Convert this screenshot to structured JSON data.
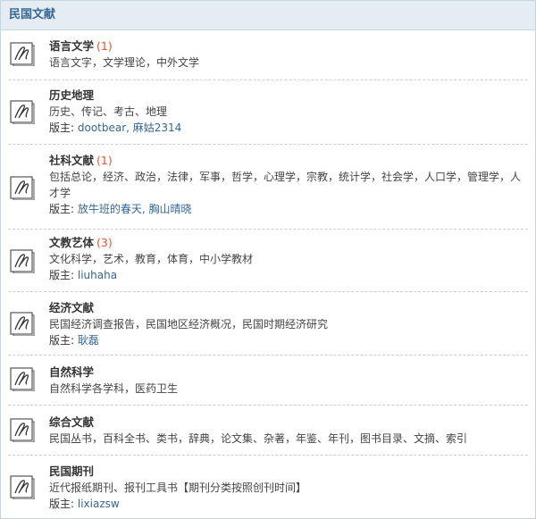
{
  "header": {
    "title": "民国文献"
  },
  "moderator_label": "版主: ",
  "forums": [
    {
      "title": "语言文学",
      "count": "(1)",
      "desc": "语言文字，文学理论，中外文学",
      "moderators": ""
    },
    {
      "title": "历史地理",
      "count": "",
      "desc": "历史、传记、考古、地理",
      "moderators": "dootbear, 麻姑2314"
    },
    {
      "title": "社科文献",
      "count": "(1)",
      "desc": "包括总论，经济、政治，法律，军事，哲学，心理学，宗教，统计学，社会学，人口学，管理学，人才学",
      "moderators": "放牛班的春天, 胸山晴晓"
    },
    {
      "title": "文教艺体",
      "count": "(3)",
      "desc": "文化科学，艺术，教育，体育，中小学教材",
      "moderators": "liuhaha"
    },
    {
      "title": "经济文献",
      "count": "",
      "desc": "民国经济调查报告，民国地区经济概况，民国时期经济研究",
      "moderators": "耿磊"
    },
    {
      "title": "自然科学",
      "count": "",
      "desc": "自然科学各学科，医药卫生",
      "moderators": ""
    },
    {
      "title": "综合文献",
      "count": "",
      "desc": "民国丛书，百科全书、类书，辞典，论文集、杂著，年鉴、年刊，图书目录、文摘、索引",
      "moderators": ""
    },
    {
      "title": "民国期刊",
      "count": "",
      "desc": "近代报纸期刊、报刊工具书【期刊分类按照创刊时间】",
      "moderators": "lixiazsw"
    }
  ],
  "colors": {
    "header_bg": "#e5edf2",
    "border": "#c2d5e3",
    "link": "#336699",
    "count": "#ee5023"
  },
  "icons": {
    "forum_icon": "forum-book-icon"
  }
}
